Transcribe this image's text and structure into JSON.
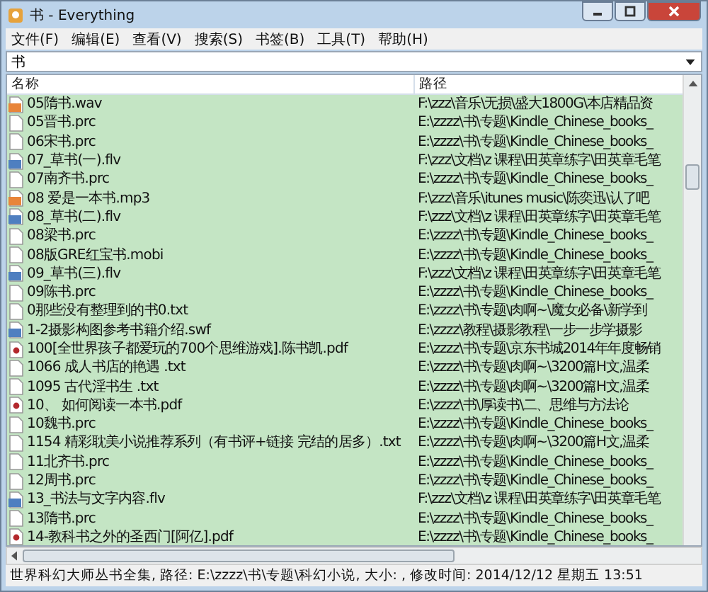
{
  "window": {
    "title": "书 - Everything"
  },
  "menu": [
    "文件(F)",
    "编辑(E)",
    "查看(V)",
    "搜索(S)",
    "书签(B)",
    "工具(T)",
    "帮助(H)"
  ],
  "search": {
    "value": "书"
  },
  "table": {
    "columns": [
      "名称",
      "路径"
    ],
    "rows": [
      {
        "kind": "audio",
        "name": "05隋书.wav",
        "path": "F:\\zzz\\音乐\\无损\\盛大1800G\\本店精品资"
      },
      {
        "kind": "text",
        "name": "05晋书.prc",
        "path": "E:\\zzzz\\书\\专题\\Kindle_Chinese_books_"
      },
      {
        "kind": "text",
        "name": "06宋书.prc",
        "path": "E:\\zzzz\\书\\专题\\Kindle_Chinese_books_"
      },
      {
        "kind": "video",
        "name": "07_草书(一).flv",
        "path": "F:\\zzz\\文档\\z 课程\\田英章练字\\田英章毛笔"
      },
      {
        "kind": "text",
        "name": "07南齐书.prc",
        "path": "E:\\zzzz\\书\\专题\\Kindle_Chinese_books_"
      },
      {
        "kind": "audio",
        "name": "08 爱是一本书.mp3",
        "path": "F:\\zzz\\音乐\\itunes music\\陈奕迅\\认了吧"
      },
      {
        "kind": "video",
        "name": "08_草书(二).flv",
        "path": "F:\\zzz\\文档\\z 课程\\田英章练字\\田英章毛笔"
      },
      {
        "kind": "text",
        "name": "08梁书.prc",
        "path": "E:\\zzzz\\书\\专题\\Kindle_Chinese_books_"
      },
      {
        "kind": "text",
        "name": "08版GRE红宝书.mobi",
        "path": "E:\\zzzz\\书\\专题\\Kindle_Chinese_books_"
      },
      {
        "kind": "video",
        "name": "09_草书(三).flv",
        "path": "F:\\zzz\\文档\\z 课程\\田英章练字\\田英章毛笔"
      },
      {
        "kind": "text",
        "name": "09陈书.prc",
        "path": "E:\\zzzz\\书\\专题\\Kindle_Chinese_books_"
      },
      {
        "kind": "text",
        "name": "0那些没有整理到的书0.txt",
        "path": "E:\\zzzz\\书\\专题\\肉啊~\\魔女必备\\新学到"
      },
      {
        "kind": "video",
        "name": "1-2摄影构图参考书籍介绍.swf",
        "path": "E:\\zzzz\\教程\\摄影教程\\一步一步学摄影"
      },
      {
        "kind": "pdf",
        "name": "100[全世界孩子都爱玩的700个思维游戏].陈书凯.pdf",
        "path": "E:\\zzzz\\书\\专题\\京东书城2014年年度畅销"
      },
      {
        "kind": "text",
        "name": "1066 成人书店的艳遇 .txt",
        "path": "E:\\zzzz\\书\\专题\\肉啊~\\3200篇H文,温柔"
      },
      {
        "kind": "text",
        "name": "1095 古代淫书生 .txt",
        "path": "E:\\zzzz\\书\\专题\\肉啊~\\3200篇H文,温柔"
      },
      {
        "kind": "pdf",
        "name": "10、 如何阅读一本书.pdf",
        "path": "E:\\zzzz\\书\\厚读书\\二、思维与方法论"
      },
      {
        "kind": "text",
        "name": "10魏书.prc",
        "path": "E:\\zzzz\\书\\专题\\Kindle_Chinese_books_"
      },
      {
        "kind": "text",
        "name": "1154 精彩耽美小说推荐系列（有书评+链接 完结的居多）.txt",
        "path": "E:\\zzzz\\书\\专题\\肉啊~\\3200篇H文,温柔"
      },
      {
        "kind": "text",
        "name": "11北齐书.prc",
        "path": "E:\\zzzz\\书\\专题\\Kindle_Chinese_books_"
      },
      {
        "kind": "text",
        "name": "12周书.prc",
        "path": "E:\\zzzz\\书\\专题\\Kindle_Chinese_books_"
      },
      {
        "kind": "video",
        "name": "13_书法与文字内容.flv",
        "path": "F:\\zzz\\文档\\z 课程\\田英章练字\\田英章毛笔"
      },
      {
        "kind": "text",
        "name": "13隋书.prc",
        "path": "E:\\zzzz\\书\\专题\\Kindle_Chinese_books_"
      },
      {
        "kind": "pdf",
        "name": "14-教科书之外的圣西门[阿亿].pdf",
        "path": "E:\\zzzz\\书\\专题\\Kindle_Chinese_books_"
      }
    ]
  },
  "status_bar": "世界科幻大师丛书全集, 路径: E:\\zzzz\\书\\专题\\科幻小说, 大小: , 修改时间: 2014/12/12 星期五 13:51"
}
